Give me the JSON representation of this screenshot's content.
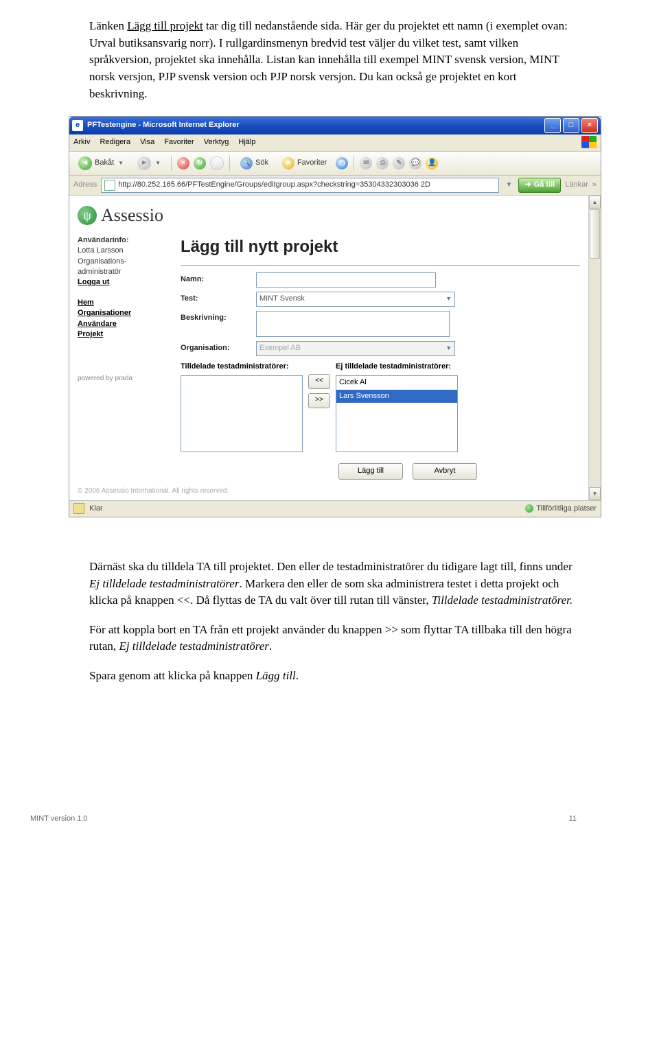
{
  "doc": {
    "intro": "Länken Lägg till projekt tar dig till nedanstående sida. Här ger du projektet ett namn (i exemplet ovan: Urval butiksansvarig norr). I rullgardinsmenyn bredvid test väljer du vilket test, samt vilken språkversion, projektet ska innehålla. Listan kan innehålla till exempel MINT svensk version, MINT norsk versjon, PJP svensk version och PJP norsk versjon. Du kan också ge projektet en kort beskrivning.",
    "link_text": "Lägg till projekt",
    "p2a": "Därnäst ska du tilldela TA till projektet. Den eller de testadministratörer du tidigare lagt till, finns under ",
    "p2b": "Ej tilldelade testadministratörer",
    "p2c": ". Markera den eller de som ska administrera testet i detta projekt och klicka på knappen <<. Då flyttas de TA du valt över till rutan till vänster, ",
    "p2d": "Tilldelade testadministratörer.",
    "p3a": "För att koppla bort en TA från ett projekt använder du knappen >> som flyttar TA tillbaka till den högra rutan, ",
    "p3b": "Ej tilldelade testadministratörer",
    "p3c": ".",
    "p4a": "Spara genom att klicka på knappen ",
    "p4b": "Lägg till",
    "p4c": "."
  },
  "ie": {
    "title": "PFTestengine - Microsoft Internet Explorer",
    "menus": [
      "Arkiv",
      "Redigera",
      "Visa",
      "Favoriter",
      "Verktyg",
      "Hjälp"
    ],
    "back": "Bakåt",
    "search": "Sök",
    "fav": "Favoriter",
    "addr_label": "Adress",
    "url": "http://80.252.165.66/PFTestEngine/Groups/editgroup.aspx?checkstring=35304332303036 2D",
    "go": "Gå till",
    "links": "Länkar",
    "status_left": "Klar",
    "status_right": "Tillförlitliga platser"
  },
  "app": {
    "brand": "Assessio",
    "side": {
      "userinfo_lbl": "Användarinfo:",
      "user_name": "Lotta Larsson",
      "user_role": "Organisations-administratör",
      "logout": "Logga ut",
      "nav_home": "Hem",
      "nav_org": "Organisationer",
      "nav_users": "Användare",
      "nav_proj": "Projekt",
      "powered": "powered by prada"
    },
    "h1": "Lägg till nytt projekt",
    "labels": {
      "name": "Namn:",
      "test": "Test:",
      "desc": "Beskrivning:",
      "org": "Organisation:",
      "assigned": "Tilldelade testadministratörer:",
      "unassigned": "Ej tilldelade testadministratörer:"
    },
    "test_value": "MINT Svensk",
    "org_value": "Exempel AB",
    "unassigned_items": [
      "Cicek Al",
      "Lars Svensson"
    ],
    "move_left": "<<",
    "move_right": ">>",
    "btn_add": "Lägg till",
    "btn_cancel": "Avbryt",
    "copyright": "© 2006 Assessio International. All rights reserved."
  },
  "footer": {
    "left": "MINT version 1.0",
    "right": "11"
  }
}
